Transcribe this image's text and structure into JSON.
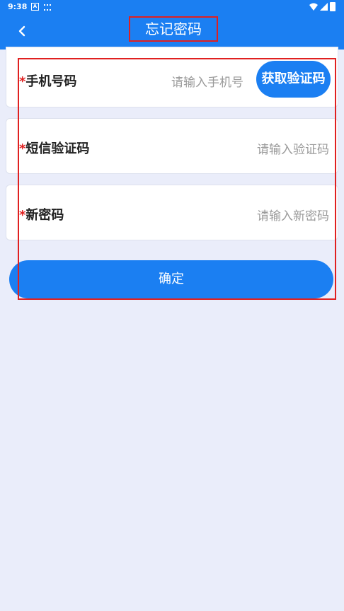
{
  "status_bar": {
    "time": "9:38",
    "icons": [
      "a-icon",
      "signal-dots-icon",
      "wifi-icon",
      "cell-signal-icon",
      "battery-icon"
    ]
  },
  "header": {
    "title": "忘记密码",
    "back_icon": "chevron-left-icon"
  },
  "form": {
    "required_marker": "*",
    "phone": {
      "label": "手机号码",
      "placeholder": "请输入手机号",
      "code_button": "获取验证码"
    },
    "sms_code": {
      "label": "短信验证码",
      "placeholder": "请输入验证码"
    },
    "new_password": {
      "label": "新密码",
      "placeholder": "请输入新密码"
    }
  },
  "confirm_label": "确定",
  "colors": {
    "primary": "#1b7ff2",
    "background": "#eaedfa",
    "required_star": "#e02020",
    "annotation_box": "#e02020"
  }
}
